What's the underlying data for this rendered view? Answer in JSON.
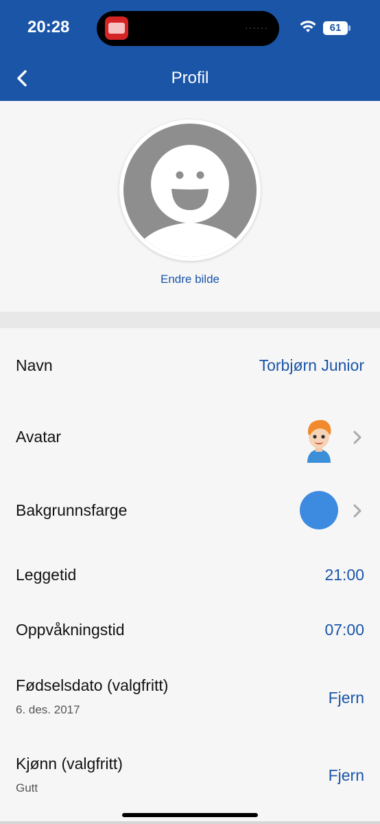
{
  "status_bar": {
    "time": "20:28",
    "battery": "61"
  },
  "nav": {
    "title": "Profil",
    "back_icon": "chevron-left-icon"
  },
  "profile": {
    "change_photo_label": "Endre bilde",
    "placeholder_icon": "smiley-person-icon"
  },
  "rows": [
    {
      "label": "Navn",
      "value": "Torbjørn Junior"
    },
    {
      "label": "Avatar",
      "icon": "cartoon-boy-avatar"
    },
    {
      "label": "Bakgrunnsfarge",
      "color": "#3d8be0"
    },
    {
      "label": "Leggetid",
      "value": "21:00"
    },
    {
      "label": "Oppvåkningstid",
      "value": "07:00"
    },
    {
      "label": "Fødselsdato (valgfritt)",
      "sub": "6. des. 2017",
      "value": "Fjern"
    },
    {
      "label": "Kjønn (valgfritt)",
      "sub": "Gutt",
      "value": "Fjern"
    }
  ],
  "colors": {
    "header": "#1a55a8",
    "accent": "#1a55a8",
    "background_color_choice": "#3d8be0"
  }
}
